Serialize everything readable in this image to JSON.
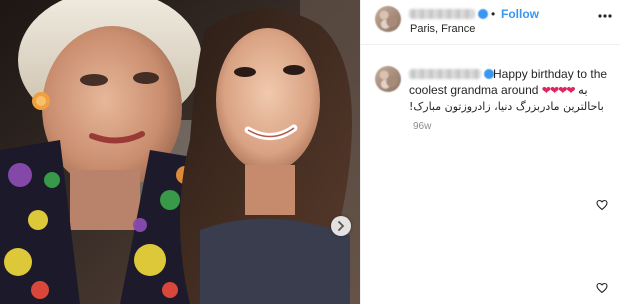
{
  "post": {
    "header": {
      "follow_separator": "•",
      "follow_label": "Follow",
      "location": "Paris, France",
      "more_icon": "more-horizontal-icon"
    },
    "caption": {
      "text_part1": "Happy birthday to the coolest grandma around",
      "hearts": "❤❤❤❤",
      "text_part2": "به",
      "persian_line": "باحالترین مادربزرگ دنیا، زادروزتون مبارک!",
      "timestamp": "96w"
    },
    "media": {
      "next_icon": "chevron-right-icon"
    },
    "colors": {
      "accent": "#3897f0",
      "heart": "#e0245e",
      "muted": "#8e8e8e",
      "text": "#262626"
    }
  }
}
